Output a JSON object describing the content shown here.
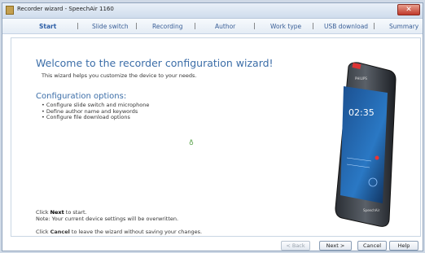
{
  "window": {
    "title": "Recorder wizard - SpeechAir 1160",
    "close_glyph": "✕"
  },
  "nav": {
    "steps": [
      "Start",
      "Slide switch",
      "Recording",
      "Author",
      "Work type",
      "USB download",
      "Summary"
    ],
    "separator": "|"
  },
  "main": {
    "welcome": "Welcome to the recorder configuration wizard!",
    "subtitle": "This wizard helps you customize the device to your needs.",
    "config_title": "Configuration options:",
    "config_items": [
      "Configure slide switch and microphone",
      "Define author name and keywords",
      "Configure file download options"
    ],
    "start_note": {
      "prefix": "Click ",
      "bold": "Next",
      "suffix": " to start."
    },
    "warning": "Note: Your current device settings will be overwritten.",
    "cancel_note": {
      "prefix": "Click ",
      "bold": "Cancel",
      "suffix": " to leave the wizard without saving your changes."
    }
  },
  "device": {
    "clock": "02:35",
    "brand": "PHILIPS",
    "model": "SpeechAir"
  },
  "buttons": {
    "back": "< Back",
    "next": "Next >",
    "cancel": "Cancel",
    "help": "Help"
  }
}
